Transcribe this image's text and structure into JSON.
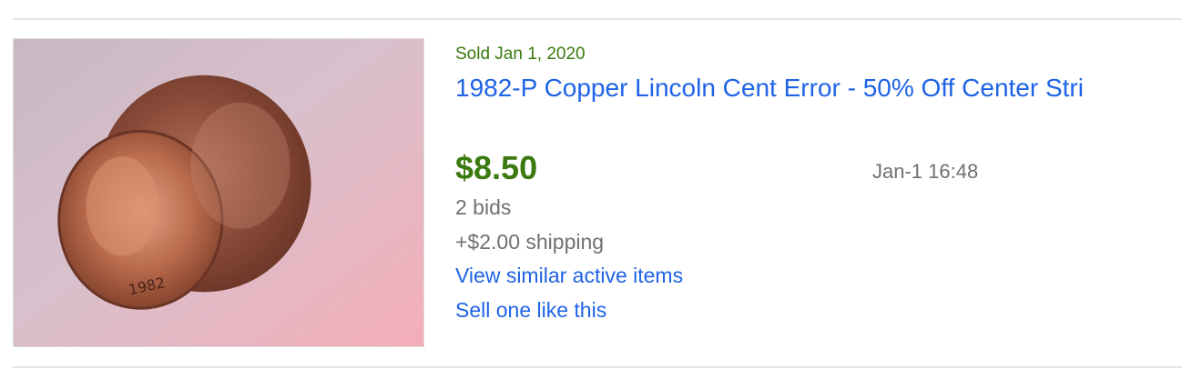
{
  "listing": {
    "image": {
      "alt_icon": "coin-photo",
      "stamp_text": "1982"
    },
    "sold_date": "Sold Jan 1, 2020",
    "title": "1982-P Copper Lincoln Cent Error - 50% Off Center Stri",
    "price": "$8.50",
    "end_time": "Jan-1 16:48",
    "bids": "2 bids",
    "shipping": "+$2.00 shipping",
    "view_similar": "View similar active items",
    "sell_one": "Sell one like this"
  },
  "colors": {
    "link_blue": "#1f63e6",
    "sold_green": "#3a7a10",
    "muted_gray": "#707070",
    "divider": "#e5e5e5"
  }
}
